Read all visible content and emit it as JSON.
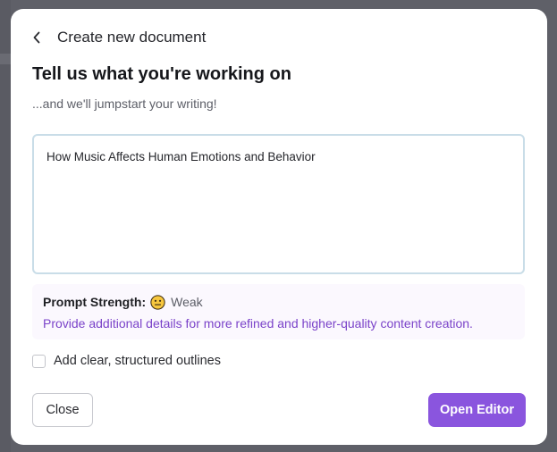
{
  "header": {
    "back_icon": "chevron-left-icon",
    "title": "Create new document"
  },
  "main": {
    "title": "Tell us what you're working on",
    "subtitle": "...and we'll jumpstart your writing!",
    "prompt_value": "How Music Affects Human Emotions and Behavior"
  },
  "strength": {
    "label": "Prompt Strength:",
    "emoji_icon": "neutral-face-icon",
    "value": "Weak",
    "hint": "Provide additional details for more refined and higher-quality content creation."
  },
  "options": {
    "outline_label": "Add clear, structured outlines",
    "outline_checked": false
  },
  "footer": {
    "close_label": "Close",
    "open_label": "Open Editor"
  },
  "colors": {
    "accent": "#8a55de",
    "hint_text": "#7a42c9",
    "strength_bg": "#fbf8fe",
    "input_border": "#c9dde8"
  }
}
